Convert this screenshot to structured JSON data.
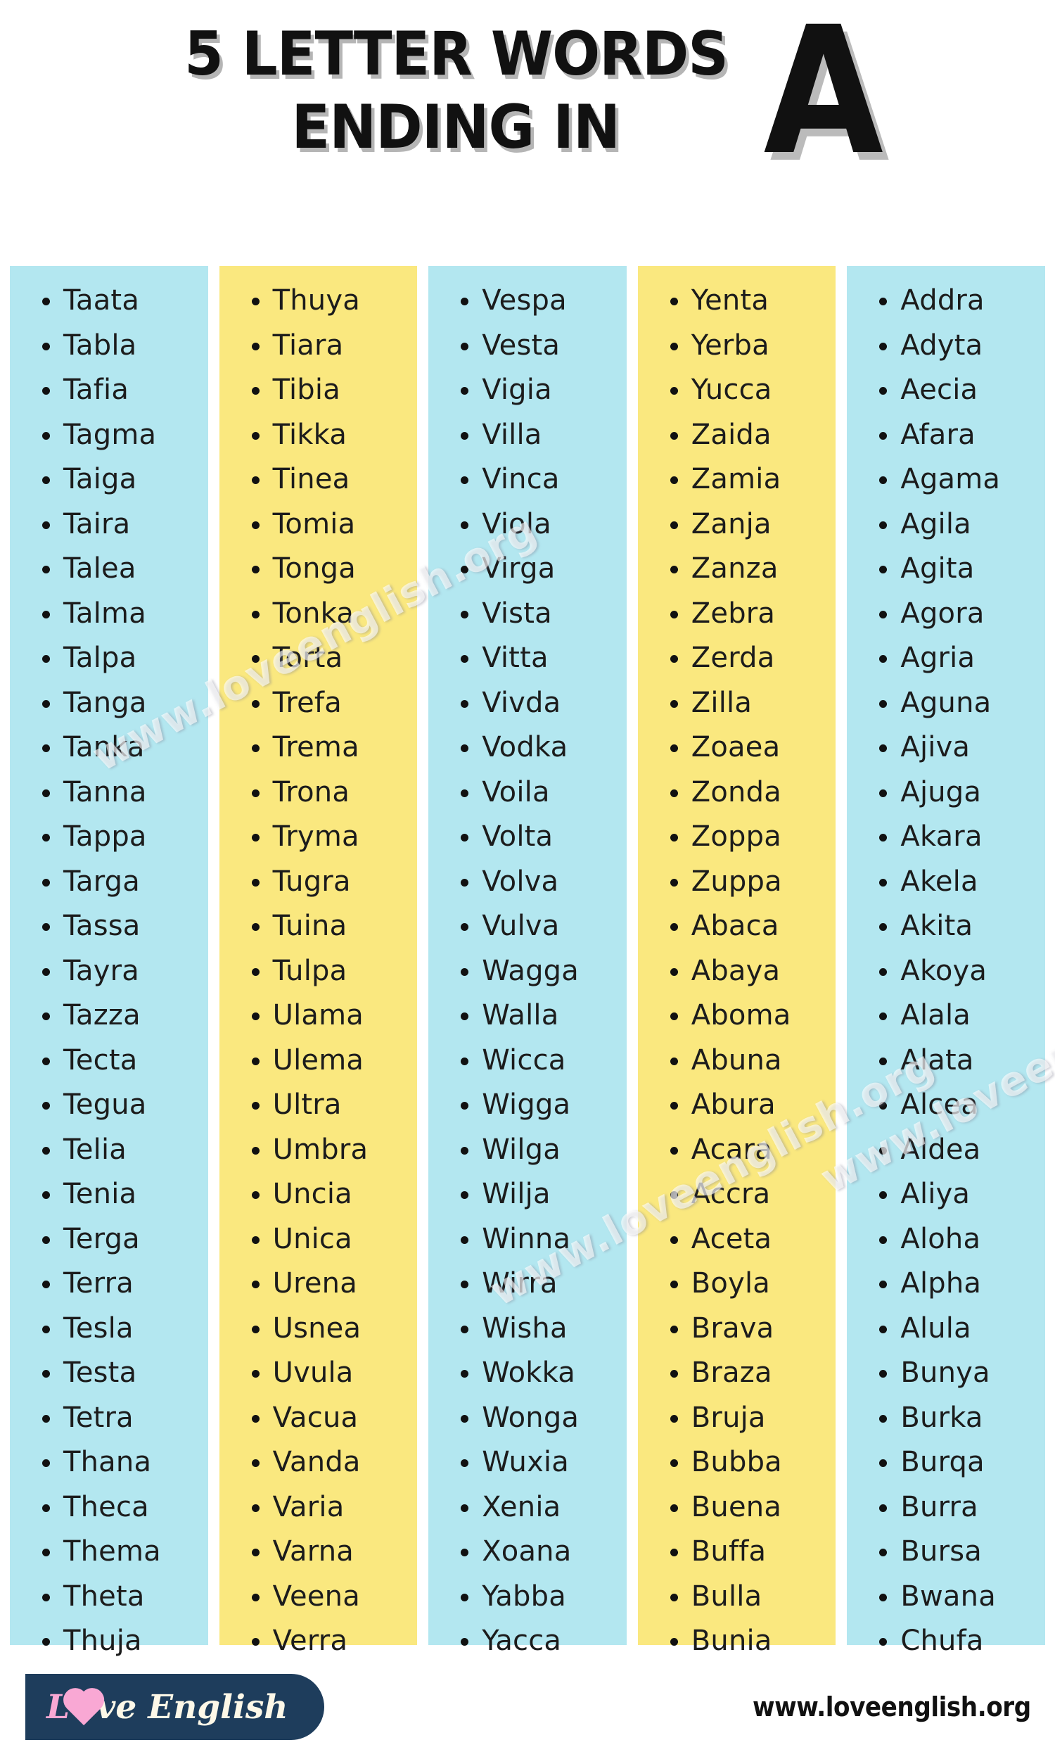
{
  "header": {
    "title_line_1": "5 LETTER WORDS",
    "title_line_2": "ENDING IN",
    "big_letter": "A"
  },
  "colors": {
    "column_blue": "#b3e7f0",
    "column_yellow": "#fae87f",
    "text": "#1c1c1c",
    "logo_background": "#1e3d5c",
    "logo_accent_pink": "#f9a8d4",
    "logo_text": "#fdf8e8"
  },
  "watermarks": [
    "www.loveenglish.org",
    "www.loveenglish.org",
    "www.loveenglish.org"
  ],
  "columns": [
    {
      "index": 1,
      "background": "blue",
      "words": [
        "Taata",
        "Tabla",
        "Tafia",
        "Tagma",
        "Taiga",
        "Taira",
        "Talea",
        "Talma",
        "Talpa",
        "Tanga",
        "Tanka",
        "Tanna",
        "Tappa",
        "Targa",
        "Tassa",
        "Tayra",
        "Tazza",
        "Tecta",
        "Tegua",
        "Telia",
        "Tenia",
        "Terga",
        "Terra",
        "Tesla",
        "Testa",
        "Tetra",
        "Thana",
        "Theca",
        "Thema",
        "Theta",
        "Thuja"
      ]
    },
    {
      "index": 2,
      "background": "yellow",
      "words": [
        "Thuya",
        "Tiara",
        "Tibia",
        "Tikka",
        "Tinea",
        "Tomia",
        "Tonga",
        "Tonka",
        "Torta",
        "Trefa",
        "Trema",
        "Trona",
        "Tryma",
        "Tugra",
        "Tuina",
        "Tulpa",
        "Ulama",
        "Ulema",
        "Ultra",
        "Umbra",
        "Uncia",
        "Unica",
        "Urena",
        "Usnea",
        "Uvula",
        "Vacua",
        "Vanda",
        "Varia",
        "Varna",
        "Veena",
        "Verra"
      ]
    },
    {
      "index": 3,
      "background": "blue",
      "words": [
        "Vespa",
        "Vesta",
        "Vigia",
        "Villa",
        "Vinca",
        "Viola",
        "Virga",
        "Vista",
        "Vitta",
        "Vivda",
        "Vodka",
        "Voila",
        "Volta",
        "Volva",
        "Vulva",
        "Wagga",
        "Walla",
        "Wicca",
        "Wigga",
        "Wilga",
        "Wilja",
        "Winna",
        "Wirra",
        "Wisha",
        "Wokka",
        "Wonga",
        "Wuxia",
        "Xenia",
        "Xoana",
        "Yabba",
        "Yacca"
      ]
    },
    {
      "index": 4,
      "background": "yellow",
      "words": [
        "Yenta",
        "Yerba",
        "Yucca",
        "Zaida",
        "Zamia",
        "Zanja",
        "Zanza",
        "Zebra",
        "Zerda",
        "Zilla",
        "Zoaea",
        "Zonda",
        "Zoppa",
        "Zuppa",
        "Abaca",
        "Abaya",
        "Aboma",
        "Abuna",
        "Abura",
        "Acara",
        "Accra",
        "Aceta",
        "Boyla",
        "Brava",
        "Braza",
        "Bruja",
        "Bubba",
        "Buena",
        "Buffa",
        "Bulla",
        "Bunia"
      ]
    },
    {
      "index": 5,
      "background": "blue",
      "words": [
        "Addra",
        "Adyta",
        "Aecia",
        "Afara",
        "Agama",
        "Agila",
        "Agita",
        "Agora",
        "Agria",
        "Aguna",
        "Ajiva",
        "Ajuga",
        "Akara",
        "Akela",
        "Akita",
        "Akoya",
        "Alala",
        "Alata",
        "Alcea",
        "Aldea",
        "Aliya",
        "Aloha",
        "Alpha",
        "Alula",
        "Bunya",
        "Burka",
        "Burqa",
        "Burra",
        "Bursa",
        "Bwana",
        "Chufa"
      ]
    }
  ],
  "footer": {
    "logo_prefix": "L",
    "logo_mid": "ve",
    "logo_suffix": "English",
    "site_url": "www.loveenglish.org"
  }
}
